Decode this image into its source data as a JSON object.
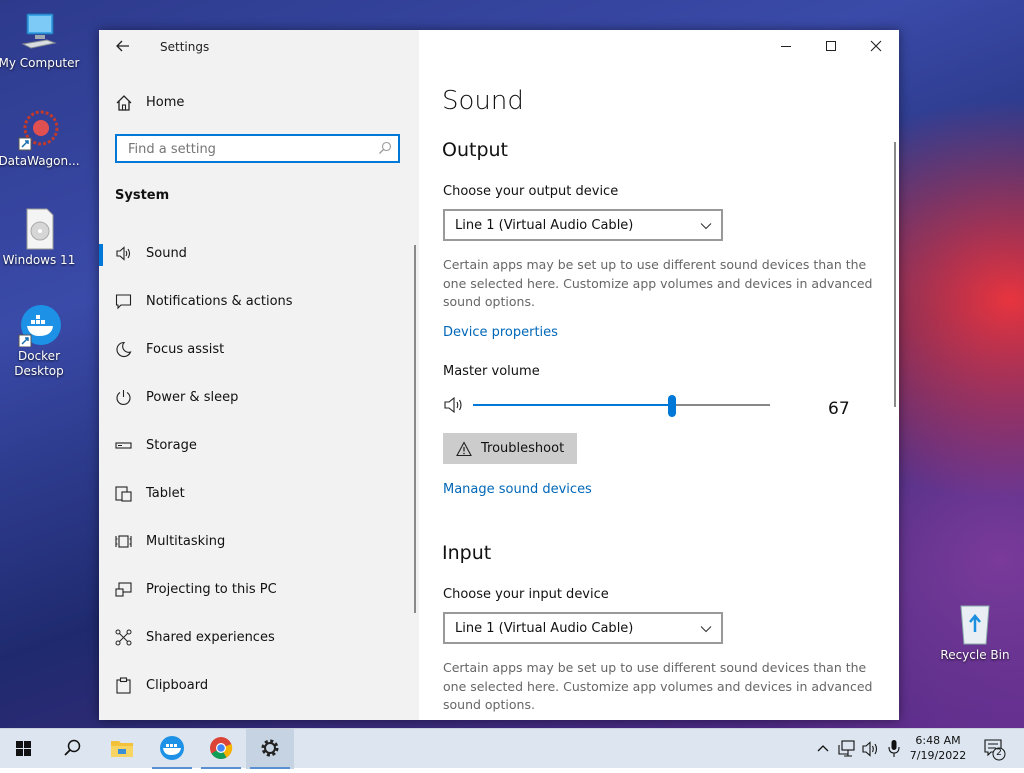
{
  "desktop": {
    "icons": [
      {
        "name": "desktop-icon-my-computer",
        "label": "My Computer"
      },
      {
        "name": "desktop-icon-datawagon",
        "label": "DataWagon..."
      },
      {
        "name": "desktop-icon-windows11",
        "label": "Windows 11"
      },
      {
        "name": "desktop-icon-docker",
        "label": "Docker Desktop"
      },
      {
        "name": "desktop-icon-recycle-bin",
        "label": "Recycle Bin"
      }
    ]
  },
  "window": {
    "title": "Settings",
    "home_label": "Home",
    "search_placeholder": "Find a setting",
    "section": "System",
    "nav": [
      {
        "label": "Sound",
        "icon": "speaker-icon",
        "active": true
      },
      {
        "label": "Notifications & actions",
        "icon": "notification-icon"
      },
      {
        "label": "Focus assist",
        "icon": "moon-icon"
      },
      {
        "label": "Power & sleep",
        "icon": "power-icon"
      },
      {
        "label": "Storage",
        "icon": "storage-icon"
      },
      {
        "label": "Tablet",
        "icon": "tablet-icon"
      },
      {
        "label": "Multitasking",
        "icon": "multitasking-icon"
      },
      {
        "label": "Projecting to this PC",
        "icon": "projecting-icon"
      },
      {
        "label": "Shared experiences",
        "icon": "shared-icon"
      },
      {
        "label": "Clipboard",
        "icon": "clipboard-icon"
      }
    ]
  },
  "content": {
    "page_title": "Sound",
    "output": {
      "heading": "Output",
      "device_label": "Choose your output device",
      "device_value": "Line 1 (Virtual Audio Cable)",
      "description": "Certain apps may be set up to use different sound devices than the one selected here. Customize app volumes and devices in advanced sound options.",
      "device_properties_link": "Device properties",
      "volume_label": "Master volume",
      "volume_value": "67",
      "volume_level": 67,
      "troubleshoot_label": "Troubleshoot",
      "manage_link": "Manage sound devices"
    },
    "input": {
      "heading": "Input",
      "device_label": "Choose your input device",
      "device_value": "Line 1 (Virtual Audio Cable)",
      "description": "Certain apps may be set up to use different sound devices than the one selected here. Customize app volumes and devices in advanced sound options."
    }
  },
  "taskbar": {
    "time": "6:48 AM",
    "date": "7/19/2022",
    "notification_count": "2"
  },
  "colors": {
    "accent": "#0078d7",
    "link": "#0067b8"
  }
}
